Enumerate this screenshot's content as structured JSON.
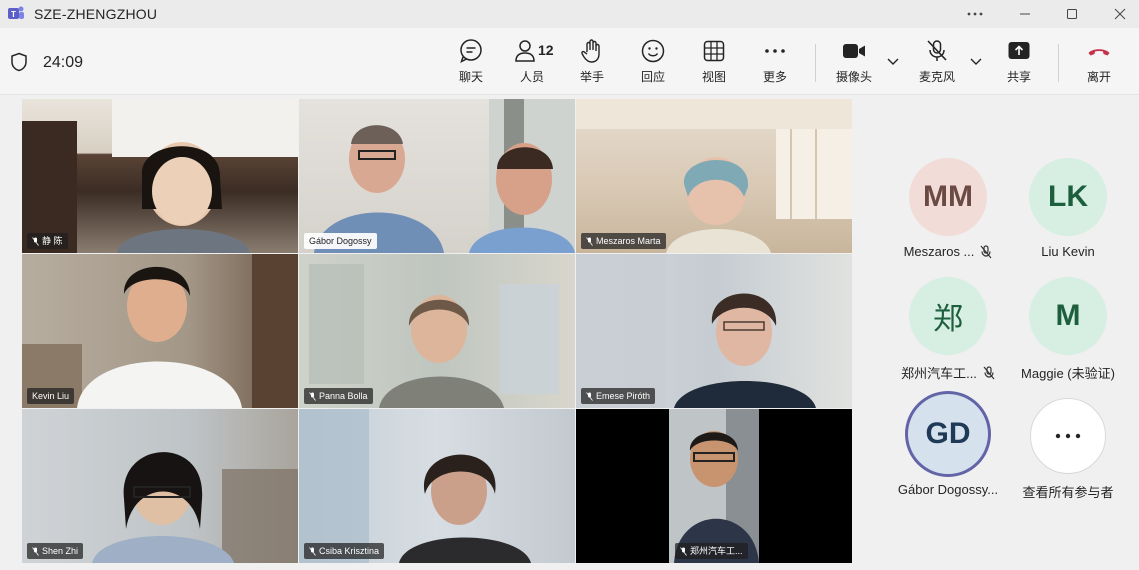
{
  "window": {
    "title": "SZE-ZHENGZHOU",
    "more_icon": "ellipsis-icon",
    "controls": [
      "minimize",
      "maximize",
      "close"
    ]
  },
  "toolbar": {
    "timer": "24:09",
    "people_count": "12",
    "chat": "聊天",
    "people": "人员",
    "raise_hand": "举手",
    "react": "回应",
    "view": "视图",
    "more": "更多",
    "camera": "摄像头",
    "mic": "麦克风",
    "share": "共享",
    "leave": "离开",
    "leave_color": "#c4314b"
  },
  "tiles": [
    {
      "name": "静 陈",
      "style": "dark"
    },
    {
      "name": "Gábor Dogossy",
      "style": "light"
    },
    {
      "name": "Meszaros Marta",
      "style": "dark"
    },
    {
      "name": "Kevin Liu",
      "style": "dark"
    },
    {
      "name": "Panna Bolla",
      "style": "dark"
    },
    {
      "name": "Emese Piróth",
      "style": "dark"
    },
    {
      "name": "Shen Zhi",
      "style": "dark"
    },
    {
      "name": "Csiba Krisztina",
      "style": "dark"
    },
    {
      "name": "郑州汽车工...",
      "style": "dark"
    }
  ],
  "roster": [
    {
      "initials": "MM",
      "name": "Meszaros ...",
      "muted": true,
      "bg": "#f1dcd8",
      "fg": "#6b4a44"
    },
    {
      "initials": "LK",
      "name": "Liu Kevin",
      "muted": false,
      "bg": "#d6efe2",
      "fg": "#1d5f3c"
    },
    {
      "initials": "郑",
      "name": "郑州汽车工...",
      "muted": true,
      "bg": "#d6efe2",
      "fg": "#1d5f3c"
    },
    {
      "initials": "M",
      "name": "Maggie (未验证)",
      "muted": false,
      "bg": "#d6efe2",
      "fg": "#1d5f3c"
    },
    {
      "initials": "GD",
      "name": "Gábor Dogossy...",
      "muted": false,
      "bg": "#d5e2ee",
      "fg": "#1e3a56",
      "speaking": true
    },
    {
      "initials": "···",
      "name": "查看所有参与者",
      "muted": false,
      "bg": "#ffffff",
      "fg": "#242424"
    }
  ]
}
